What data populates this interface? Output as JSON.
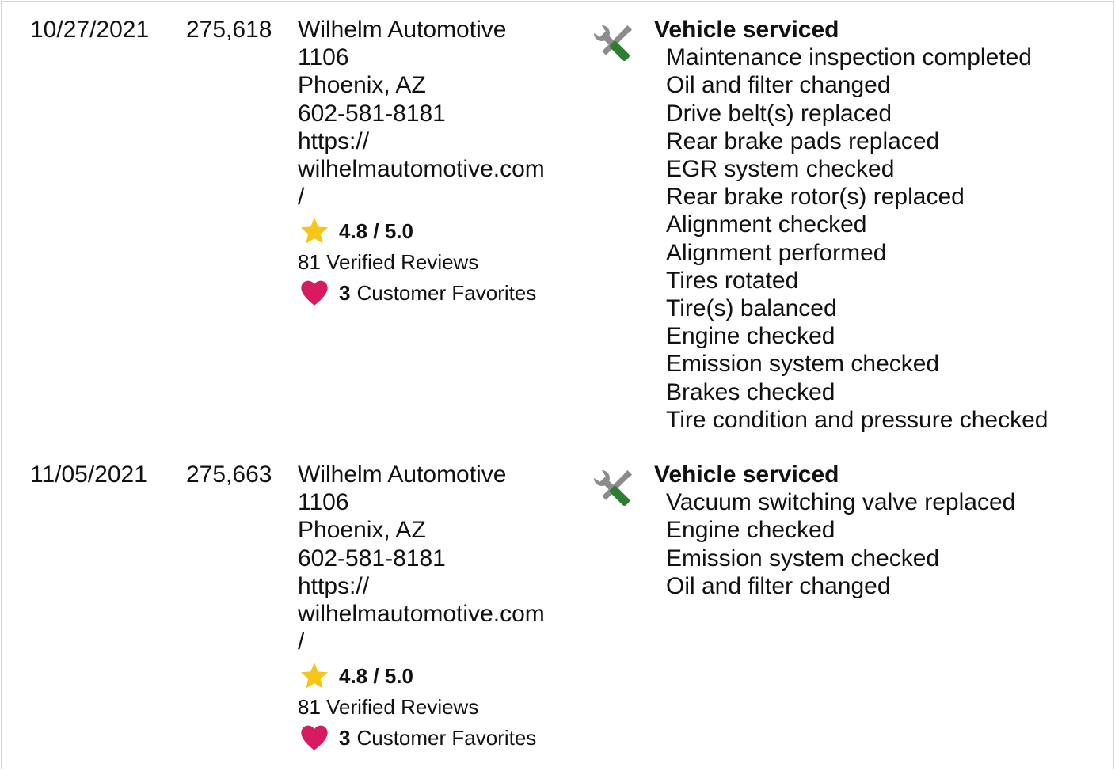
{
  "records": [
    {
      "date": "10/27/2021",
      "mileage": "275,618",
      "shop": {
        "name": "Wilhelm Automotive",
        "number": "1106",
        "location": "Phoenix, AZ",
        "phone": "602-581-8181",
        "url_line1": "https://",
        "url_line2": "wilhelmautomotive.com",
        "url_line3": "/",
        "rating": "4.8 / 5.0",
        "reviews": "81 Verified Reviews",
        "favorites_count": "3",
        "favorites_label": "Customer Favorites"
      },
      "icon": "service-tools-icon",
      "title": "Vehicle serviced",
      "items": [
        "Maintenance inspection completed",
        "Oil and filter changed",
        "Drive belt(s) replaced",
        "Rear brake pads replaced",
        "EGR system checked",
        "Rear brake rotor(s) replaced",
        "Alignment checked",
        "Alignment performed",
        "Tires rotated",
        "Tire(s) balanced",
        "Engine checked",
        "Emission system checked",
        "Brakes checked",
        "Tire condition and pressure checked"
      ]
    },
    {
      "date": "11/05/2021",
      "mileage": "275,663",
      "shop": {
        "name": "Wilhelm Automotive",
        "number": "1106",
        "location": "Phoenix, AZ",
        "phone": "602-581-8181",
        "url_line1": "https://",
        "url_line2": "wilhelmautomotive.com",
        "url_line3": "/",
        "rating": "4.8 / 5.0",
        "reviews": "81 Verified Reviews",
        "favorites_count": "3",
        "favorites_label": "Customer Favorites"
      },
      "icon": "service-tools-icon",
      "title": "Vehicle serviced",
      "items": [
        "Vacuum switching valve replaced",
        "Engine checked",
        "Emission system checked",
        "Oil and filter changed"
      ]
    }
  ],
  "colors": {
    "star": "#F5C518",
    "heart": "#D81B60",
    "wrench_handle": "#2E7D32",
    "tool_gray": "#8C8C8C",
    "divider": "#D8D8D8"
  }
}
